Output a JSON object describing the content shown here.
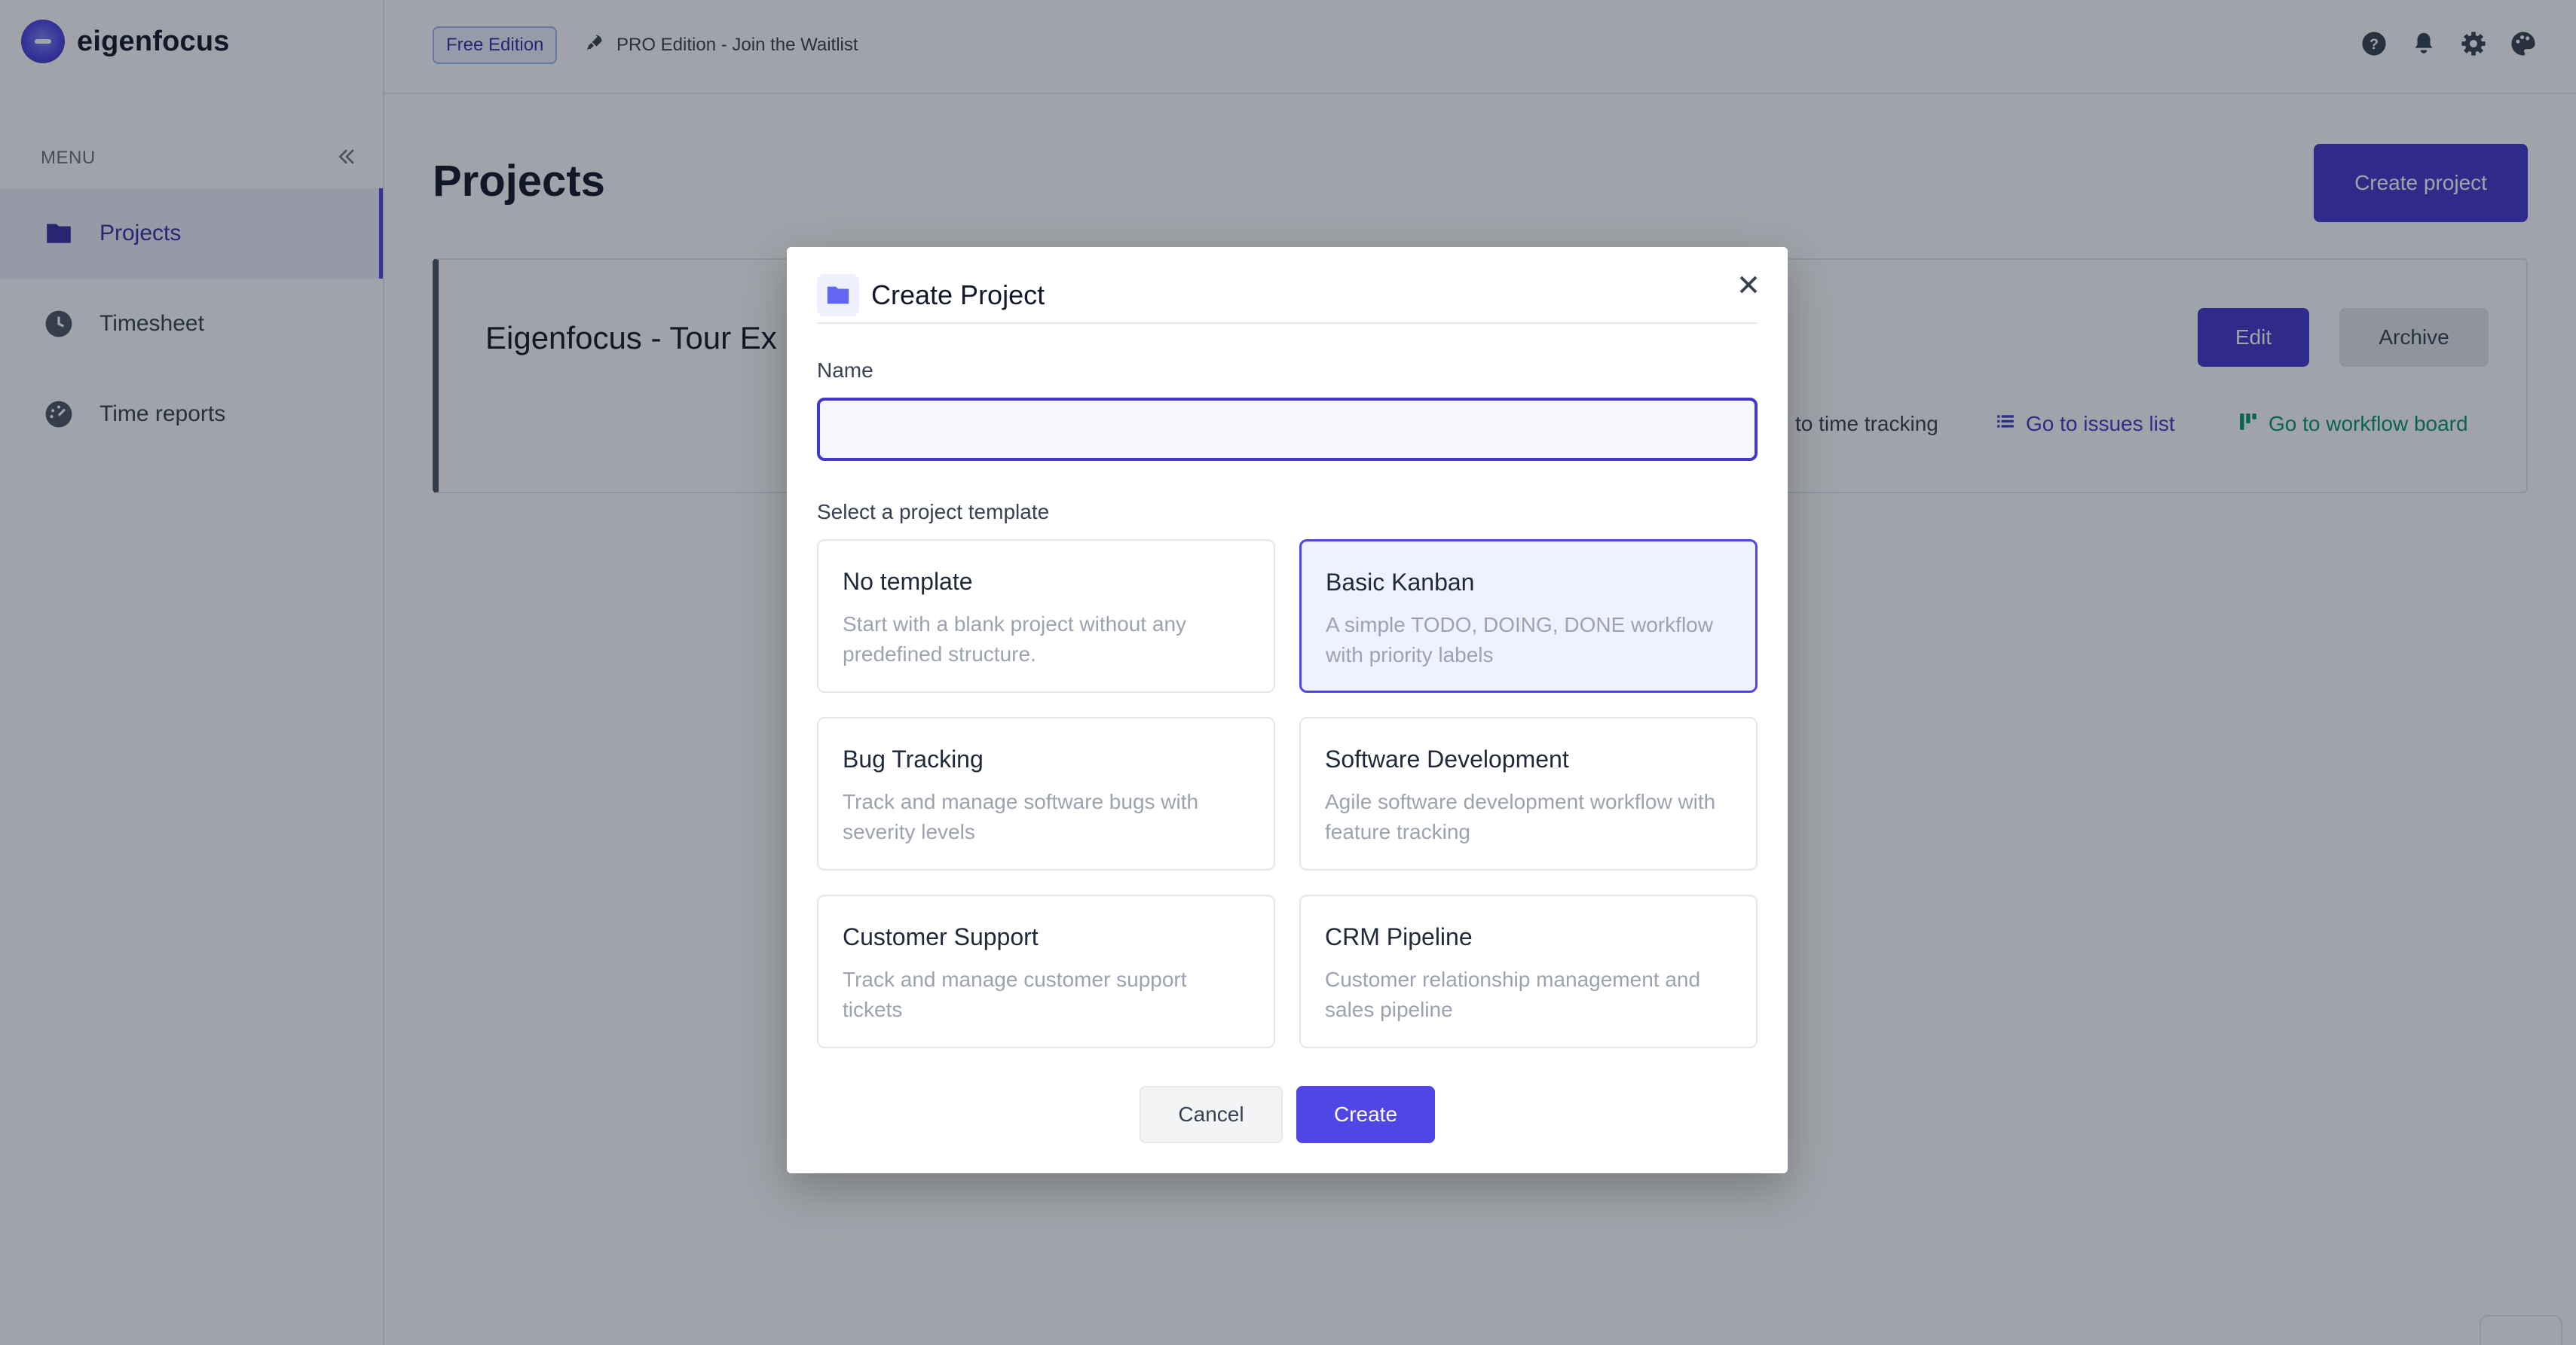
{
  "brand": {
    "name": "eigenfocus"
  },
  "topbar": {
    "edition_badge": "Free Edition",
    "pro_link": "PRO Edition - Join the Waitlist",
    "icons": [
      "help-icon",
      "bell-icon",
      "gear-icon",
      "palette-icon"
    ]
  },
  "sidebar": {
    "menu_label": "MENU",
    "items": [
      {
        "label": "Projects",
        "icon": "folder-icon",
        "active": true
      },
      {
        "label": "Timesheet",
        "icon": "clock-icon",
        "active": false
      },
      {
        "label": "Time reports",
        "icon": "gauge-icon",
        "active": false
      }
    ]
  },
  "main": {
    "title": "Projects",
    "create_button": "Create project",
    "project": {
      "name": "Eigenfocus - Tour Ex",
      "edit": "Edit",
      "archive": "Archive",
      "links": {
        "time_tracking": "to time tracking",
        "issues": "Go to issues list",
        "board": "Go to workflow board"
      }
    }
  },
  "modal": {
    "title": "Create Project",
    "name_label": "Name",
    "name_value": "",
    "template_label": "Select a project template",
    "templates": [
      {
        "title": "No template",
        "desc": "Start with a blank project without any predefined structure."
      },
      {
        "title": "Basic Kanban",
        "desc": "A simple TODO, DOING, DONE workflow with priority labels"
      },
      {
        "title": "Bug Tracking",
        "desc": "Track and manage software bugs with severity levels"
      },
      {
        "title": "Software Development",
        "desc": "Agile software development workflow with feature tracking"
      },
      {
        "title": "Customer Support",
        "desc": "Track and manage customer support tickets"
      },
      {
        "title": "CRM Pipeline",
        "desc": "Customer relationship management and sales pipeline"
      }
    ],
    "selected_template": "Basic Kanban",
    "cancel": "Cancel",
    "create": "Create"
  },
  "colors": {
    "primary": "#4338ca",
    "accent": "#4f46e5",
    "success": "#059669",
    "overlay": "rgba(17,24,39,0.4)"
  }
}
